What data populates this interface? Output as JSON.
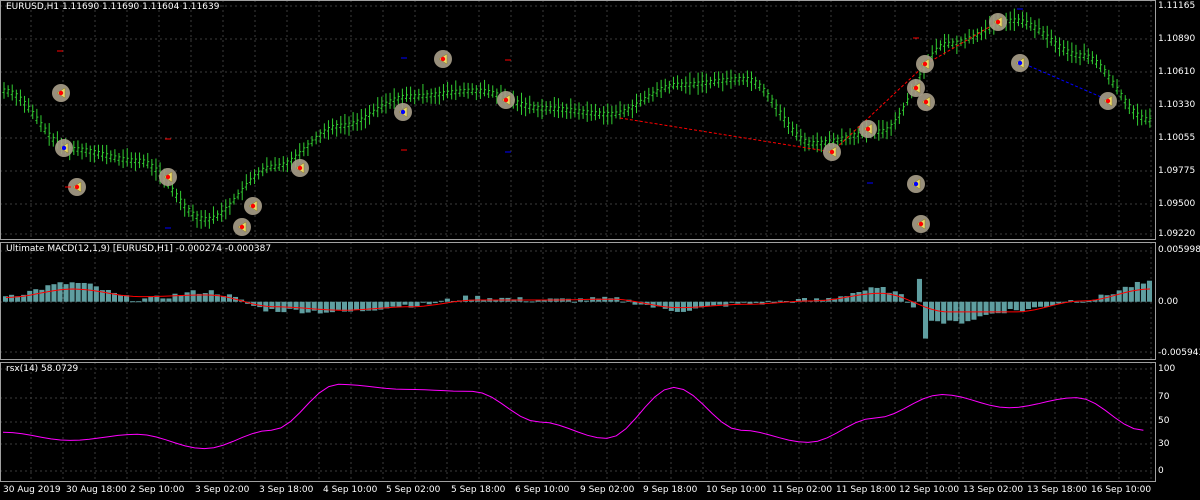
{
  "main_chart": {
    "title": "EURUSD,H1  1.11690 1.11690 1.11604 1.11639",
    "price_levels": [
      "1.11165",
      "1.10890",
      "1.10610",
      "1.10330",
      "1.10055",
      "1.09775",
      "1.09500",
      "1.09220"
    ],
    "colors": {
      "bull_bar": "#32cd32",
      "background": "#000000",
      "grid": "#404040",
      "arrow_red": "#ff0000",
      "arrow_blue": "#0000ff",
      "signal_circle": "#a89f8a",
      "signal_arrow": "#e8d86a"
    }
  },
  "macd_pane": {
    "title": "Ultimate MACD(12,1,9) [EURUSD,H1] -0.000274 -0.000387",
    "levels": [
      "0.005998",
      "0.00",
      "-0.005943"
    ],
    "colors": {
      "histogram": "#5f9ea0",
      "signal_line": "#ff0000"
    }
  },
  "rsx_pane": {
    "title": "rsx(14) 58.0729",
    "levels": [
      "100",
      "70",
      "50",
      "30",
      "0"
    ],
    "colors": {
      "line": "#ff00ff"
    }
  },
  "time_axis": [
    "30 Aug 2019",
    "30 Aug 18:00",
    "2 Sep 10:00",
    "3 Sep 02:00",
    "3 Sep 18:00",
    "4 Sep 10:00",
    "5 Sep 02:00",
    "5 Sep 18:00",
    "6 Sep 10:00",
    "9 Sep 02:00",
    "9 Sep 18:00",
    "10 Sep 10:00",
    "11 Sep 02:00",
    "11 Sep 18:00",
    "12 Sep 10:00",
    "13 Sep 02:00",
    "13 Sep 18:00",
    "16 Sep 10:00"
  ],
  "chart_data": [
    {
      "type": "line",
      "title": "EURUSD,H1  1.11690 1.11690 1.11604 1.11639",
      "x": [
        "30 Aug 2019",
        "30 Aug 18:00",
        "2 Sep 10:00",
        "3 Sep 02:00",
        "3 Sep 18:00",
        "4 Sep 10:00",
        "5 Sep 02:00",
        "5 Sep 18:00",
        "6 Sep 10:00",
        "9 Sep 02:00",
        "9 Sep 18:00",
        "10 Sep 10:00",
        "11 Sep 02:00",
        "11 Sep 18:00",
        "12 Sep 10:00",
        "13 Sep 02:00",
        "13 Sep 18:00",
        "16 Sep 10:00"
      ],
      "series": [
        {
          "values": [
            1.1045,
            1.0995,
            1.0985,
            1.0935,
            1.098,
            1.1015,
            1.104,
            1.1045,
            1.103,
            1.1025,
            1.105,
            1.1055,
            1.1,
            1.101,
            1.1085,
            1.1105,
            1.1075,
            1.102
          ]
        }
      ],
      "ylim": [
        1.0922,
        1.1117
      ]
    },
    {
      "type": "bar",
      "title": "Ultimate MACD(12,1,9) [EURUSD,H1] -0.000274 -0.000387",
      "x": [
        "30 Aug 2019",
        "30 Aug 18:00",
        "2 Sep 10:00",
        "3 Sep 02:00",
        "3 Sep 18:00",
        "4 Sep 10:00",
        "5 Sep 02:00",
        "5 Sep 18:00",
        "6 Sep 10:00",
        "9 Sep 02:00",
        "9 Sep 18:00",
        "10 Sep 10:00",
        "11 Sep 02:00",
        "11 Sep 18:00",
        "12 Sep 10:00",
        "13 Sep 02:00",
        "13 Sep 18:00",
        "16 Sep 10:00"
      ],
      "series": [
        {
          "values": [
            0.0008,
            0.0022,
            0.0003,
            0.0012,
            -0.001,
            -0.0012,
            -0.0004,
            0.0005,
            0.0002,
            0.0003,
            -0.001,
            -0.0002,
            0.0002,
            0.0015,
            -0.0025,
            -0.001,
            0.0002,
            0.0022
          ]
        },
        {
          "values": [
            0.0005,
            0.0015,
            0.0006,
            0.0008,
            -0.0006,
            -0.001,
            -0.0006,
            0.0002,
            0.0002,
            0.0003,
            -0.0007,
            -0.0003,
            0.0001,
            0.001,
            -0.0012,
            -0.0012,
            0.0001,
            0.0015
          ]
        }
      ],
      "ylim": [
        -0.005943,
        0.005998
      ]
    },
    {
      "type": "line",
      "title": "rsx(14) 58.0729",
      "x": [
        "30 Aug 2019",
        "30 Aug 18:00",
        "2 Sep 10:00",
        "3 Sep 02:00",
        "3 Sep 18:00",
        "4 Sep 10:00",
        "5 Sep 02:00",
        "5 Sep 18:00",
        "6 Sep 10:00",
        "9 Sep 02:00",
        "9 Sep 18:00",
        "10 Sep 10:00",
        "11 Sep 02:00",
        "11 Sep 18:00",
        "12 Sep 10:00",
        "13 Sep 02:00",
        "13 Sep 18:00",
        "16 Sep 10:00"
      ],
      "series": [
        {
          "values": [
            38,
            30,
            36,
            22,
            40,
            85,
            80,
            78,
            48,
            32,
            82,
            40,
            28,
            52,
            75,
            62,
            72,
            40
          ]
        }
      ],
      "ylim": [
        0,
        100
      ]
    }
  ]
}
